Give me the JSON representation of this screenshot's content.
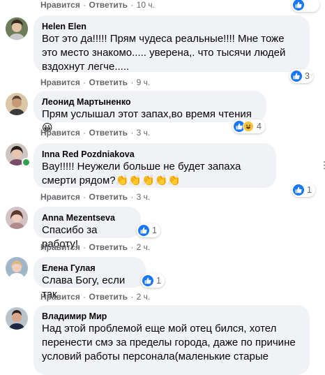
{
  "actions": {
    "like": "Нравится",
    "reply": "Ответить",
    "sep": "·"
  },
  "comments": [
    {
      "time": "10 ч."
    },
    {
      "author": "Helen Elen",
      "text": "Вот это да!!!!! Прям чудеса реальные!!!! Мне тоже это место знакомо..... уверена,. что тысячи людей вздохнут легче.....",
      "time": "9 ч.",
      "reactions": {
        "count": "3",
        "icons": [
          "like-icon"
        ]
      }
    },
    {
      "author": "Леонид Мартыненко",
      "text": "Прям услышал этот запах,во время чтения😀",
      "time": "3 ч.",
      "reactions": {
        "count": "4",
        "icons": [
          "like-icon",
          "haha-icon"
        ]
      }
    },
    {
      "author": "Inna Red Pozdniakova",
      "text": "Вау!!!!! Неужели больше не будет запаха смерти рядом?👏👏👏👏👏",
      "time": "3 ч.",
      "reactions": {
        "count": "1",
        "icons": [
          "like-icon"
        ]
      }
    },
    {
      "author": "Anna Mezentseva",
      "text": "Спасибо за работу!",
      "time": "2 ч.",
      "reactions": {
        "count": "1",
        "icons": [
          "like-icon"
        ]
      }
    },
    {
      "author": "Елена Гулая",
      "text": "Слава Богу, если так",
      "time": "2 ч.",
      "reactions": {
        "count": "1",
        "icons": [
          "like-icon"
        ]
      }
    },
    {
      "author": "Владимир Мир",
      "text": "Над этой проблемой еще мой отец бился, хотел перенести смэ за пределы города, даже по причине условий работы персонала(маленькие старые"
    }
  ],
  "colors": {
    "like_blue": "#1877f2",
    "bubble_bg": "#f0f2f5",
    "meta_gray": "#65676b",
    "online_green": "#31a24c"
  }
}
